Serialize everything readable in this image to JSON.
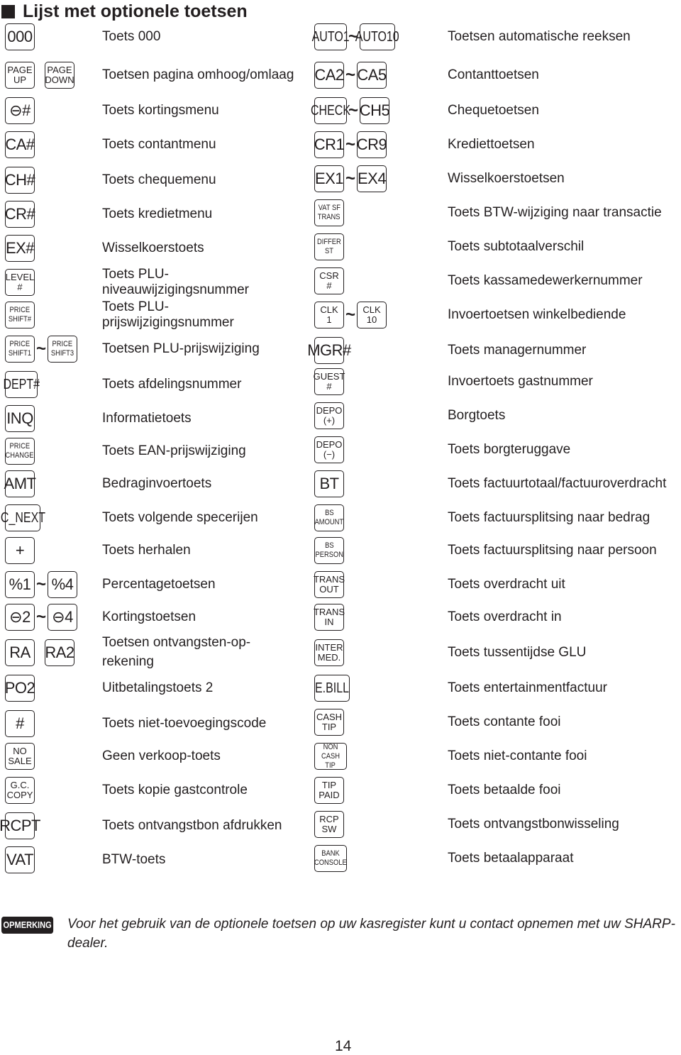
{
  "title": "Lijst met optionele toetsen",
  "left_column": [
    {
      "keys": [
        [
          "000"
        ]
      ],
      "range": false,
      "desc": "Toets 000"
    },
    {
      "keys": [
        [
          "PAGE",
          "UP"
        ],
        [
          "PAGE",
          "DOWN"
        ]
      ],
      "range": false,
      "desc": "Toetsen pagina omhoog/omlaag"
    },
    {
      "keys": [
        [
          "⊖#"
        ]
      ],
      "range": false,
      "desc": "Toets kortingsmenu"
    },
    {
      "keys": [
        [
          "CA#"
        ]
      ],
      "range": false,
      "desc": "Toets contantmenu"
    },
    {
      "keys": [
        [
          "CH#"
        ]
      ],
      "range": false,
      "desc": "Toets chequemenu"
    },
    {
      "keys": [
        [
          "CR#"
        ]
      ],
      "range": false,
      "desc": "Toets kredietmenu"
    },
    {
      "keys": [
        [
          "EX#"
        ]
      ],
      "range": false,
      "desc": "Wisselkoerstoets"
    },
    {
      "keys": [
        [
          "LEVEL",
          "#"
        ]
      ],
      "range": false,
      "desc": "Toets PLU-niveauwijzigingsnummer",
      "desc_lines": [
        "Toets PLU-",
        "niveauwijzigingsnummer"
      ]
    },
    {
      "keys": [
        [
          "PRICE",
          "SHIFT#"
        ]
      ],
      "range": false,
      "desc": "Toets PLU-prijswijzigingsnummer",
      "desc_lines": [
        "Toets PLU-",
        "prijswijzigingsnummer"
      ]
    },
    {
      "keys": [
        [
          "PRICE",
          "SHIFT1"
        ],
        [
          "PRICE",
          "SHIFT3"
        ]
      ],
      "range": true,
      "desc": "Toetsen PLU-prijswijziging"
    },
    {
      "keys": [
        [
          "DEPT#"
        ]
      ],
      "range": false,
      "desc": "Toets afdelingsnummer"
    },
    {
      "keys": [
        [
          "INQ"
        ]
      ],
      "range": false,
      "desc": "Informatietoets"
    },
    {
      "keys": [
        [
          "PRICE",
          "CHANGE"
        ]
      ],
      "range": false,
      "desc": "Toets EAN-prijswijziging"
    },
    {
      "keys": [
        [
          "AMT"
        ]
      ],
      "range": false,
      "desc": "Bedraginvoertoets"
    },
    {
      "keys": [
        [
          "C_NEXT"
        ]
      ],
      "range": false,
      "desc": "Toets volgende specerijen"
    },
    {
      "keys": [
        [
          "+"
        ]
      ],
      "range": false,
      "desc": "Toets herhalen"
    },
    {
      "keys": [
        [
          "%1"
        ],
        [
          "%4"
        ]
      ],
      "range": true,
      "desc": "Percentagetoetsen"
    },
    {
      "keys": [
        [
          "⊖2"
        ],
        [
          "⊖4"
        ]
      ],
      "range": true,
      "desc": "Kortingstoetsen"
    },
    {
      "keys": [
        [
          "RA"
        ],
        [
          "RA2"
        ]
      ],
      "range": false,
      "desc": "Toetsen ontvangsten-op-rekening",
      "desc_lines": [
        "Toetsen ontvangsten-op-",
        "rekening"
      ]
    },
    {
      "keys": [
        [
          "PO2"
        ]
      ],
      "range": false,
      "desc": "Uitbetalingstoets 2"
    },
    {
      "keys": [
        [
          "#"
        ]
      ],
      "range": false,
      "desc": "Toets niet-toevoegingscode"
    },
    {
      "keys": [
        [
          "NO",
          "SALE"
        ]
      ],
      "range": false,
      "desc": "Geen verkoop-toets"
    },
    {
      "keys": [
        [
          "G.C.",
          "COPY"
        ]
      ],
      "range": false,
      "desc": "Toets kopie gastcontrole"
    },
    {
      "keys": [
        [
          "RCPT"
        ]
      ],
      "range": false,
      "desc": "Toets ontvangstbon afdrukken"
    },
    {
      "keys": [
        [
          "VAT"
        ]
      ],
      "range": false,
      "desc": "BTW-toets"
    }
  ],
  "right_column": [
    {
      "keys": [
        [
          "AUTO1"
        ],
        [
          "AUTO10"
        ]
      ],
      "range": true,
      "desc": "Toetsen automatische reeksen"
    },
    {
      "keys": [
        [
          "CA2"
        ],
        [
          "CA5"
        ]
      ],
      "range": true,
      "desc": "Contanttoetsen"
    },
    {
      "keys": [
        [
          "CHECK"
        ],
        [
          "CH5"
        ]
      ],
      "range": true,
      "desc": "Chequetoetsen"
    },
    {
      "keys": [
        [
          "CR1"
        ],
        [
          "CR9"
        ]
      ],
      "range": true,
      "desc": "Krediettoetsen"
    },
    {
      "keys": [
        [
          "EX1"
        ],
        [
          "EX4"
        ]
      ],
      "range": true,
      "desc": "Wisselkoerstoetsen"
    },
    {
      "keys": [
        [
          "VAT SF",
          "TRANS"
        ]
      ],
      "range": false,
      "desc": "Toets BTW-wijziging naar transactie"
    },
    {
      "keys": [
        [
          "DIFFER",
          "ST"
        ]
      ],
      "range": false,
      "desc": "Toets subtotaalverschil"
    },
    {
      "keys": [
        [
          "CSR",
          "#"
        ]
      ],
      "range": false,
      "desc": "Toets kassamedewerkernummer"
    },
    {
      "keys": [
        [
          "CLK",
          "1"
        ],
        [
          "CLK",
          "10"
        ]
      ],
      "range": true,
      "desc": "Invoertoetsen winkelbediende"
    },
    {
      "keys": [
        [
          "MGR#"
        ]
      ],
      "range": false,
      "desc": "Toets managernummer"
    },
    {
      "keys": [
        [
          "GUEST",
          "#"
        ]
      ],
      "range": false,
      "desc": "Invoertoets gastnummer"
    },
    {
      "keys": [
        [
          "DEPO",
          "(+)"
        ]
      ],
      "range": false,
      "desc": "Borgtoets"
    },
    {
      "keys": [
        [
          "DEPO",
          "(−)"
        ]
      ],
      "range": false,
      "desc": "Toets borgteruggave"
    },
    {
      "keys": [
        [
          "BT"
        ]
      ],
      "range": false,
      "desc": "Toets factuurtotaal/factuuroverdracht"
    },
    {
      "keys": [
        [
          "BS",
          "AMOUNT"
        ]
      ],
      "range": false,
      "desc": "Toets factuursplitsing naar bedrag"
    },
    {
      "keys": [
        [
          "BS",
          "PERSON"
        ]
      ],
      "range": false,
      "desc": "Toets factuursplitsing naar persoon"
    },
    {
      "keys": [
        [
          "TRANS",
          "OUT"
        ]
      ],
      "range": false,
      "desc": "Toets overdracht uit"
    },
    {
      "keys": [
        [
          "TRANS",
          "IN"
        ]
      ],
      "range": false,
      "desc": "Toets overdracht in"
    },
    {
      "keys": [
        [
          "INTER",
          "MED."
        ]
      ],
      "range": false,
      "desc": "Toets tussentijdse GLU"
    },
    {
      "keys": [
        [
          "E.BILL"
        ]
      ],
      "range": false,
      "desc": "Toets entertainmentfactuur"
    },
    {
      "keys": [
        [
          "CASH",
          "TIP"
        ]
      ],
      "range": false,
      "desc": "Toets contante fooi"
    },
    {
      "keys": [
        [
          "NON CASH",
          "TIP"
        ]
      ],
      "range": false,
      "desc": "Toets niet-contante fooi"
    },
    {
      "keys": [
        [
          "TIP",
          "PAID"
        ]
      ],
      "range": false,
      "desc": "Toets betaalde fooi"
    },
    {
      "keys": [
        [
          "RCP",
          "SW"
        ]
      ],
      "range": false,
      "desc": "Toets ontvangstbonwisseling"
    },
    {
      "keys": [
        [
          "BANK",
          "CONSOLE"
        ]
      ],
      "range": false,
      "desc": "Toets betaalapparaat"
    }
  ],
  "range_symbol": "~",
  "note": {
    "badge": "OPMERKING",
    "text": "Voor het gebruik van de optionele toetsen op uw kasregister kunt u contact opnemen met uw SHARP-dealer."
  },
  "page_number": "14"
}
